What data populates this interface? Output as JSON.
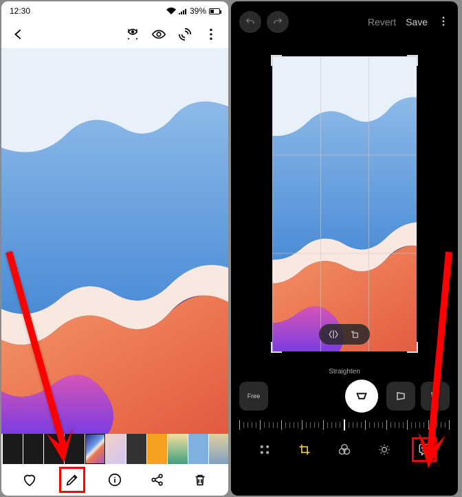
{
  "status": {
    "time": "12:30",
    "battery": "39%"
  },
  "editor": {
    "revert_label": "Revert",
    "save_label": "Save",
    "straighten_label": "Straighten",
    "free_label": "Free"
  },
  "icons": {
    "back": "back-icon",
    "bixby_vision": "bixby-vision-icon",
    "ar": "ar-icon",
    "dynamic": "dynamic-icon",
    "more": "more-icon",
    "favorite": "heart-icon",
    "edit": "pencil-icon",
    "info": "info-icon",
    "share": "share-icon",
    "delete": "trash-icon",
    "undo": "undo-icon",
    "redo": "redo-icon",
    "flip_h": "flip-horizontal-icon",
    "rotate": "rotate-icon",
    "transform": "transform-icon",
    "skew_h": "skew-horizontal-icon",
    "skew_v": "skew-vertical-icon",
    "stickers": "stickers-icon",
    "crop_mode": "crop-mode-icon",
    "filters": "filters-icon",
    "adjust": "adjust-icon",
    "decorate": "decorate-icon"
  }
}
